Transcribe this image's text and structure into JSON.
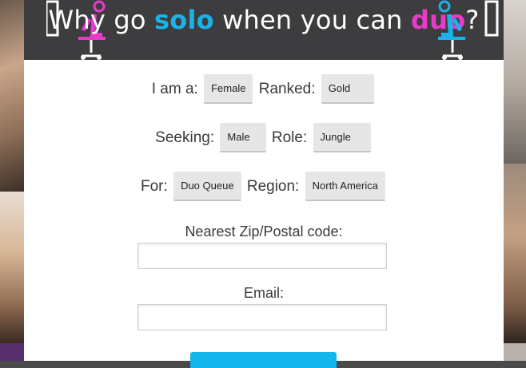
{
  "banner": {
    "title_pre": "Why go ",
    "title_solo": "solo",
    "title_mid": " when you can ",
    "title_duo": "duo",
    "title_end": "?"
  },
  "form": {
    "row1": {
      "label_a": "I am a:",
      "value_a": "Female",
      "label_b": "Ranked:",
      "value_b": "Gold"
    },
    "row2": {
      "label_a": "Seeking:",
      "value_a": "Male",
      "label_b": "Role:",
      "value_b": "Jungle"
    },
    "row3": {
      "label_a": "For:",
      "value_a": "Duo Queue",
      "label_b": "Region:",
      "value_b": "North America"
    },
    "zip_label": "Nearest Zip/Postal code:",
    "zip_value": "",
    "email_label": "Email:",
    "email_value": ""
  },
  "colors": {
    "accent_blue": "#12b5ec",
    "accent_pink": "#e83acb",
    "banner_bg": "#3d3d40"
  }
}
